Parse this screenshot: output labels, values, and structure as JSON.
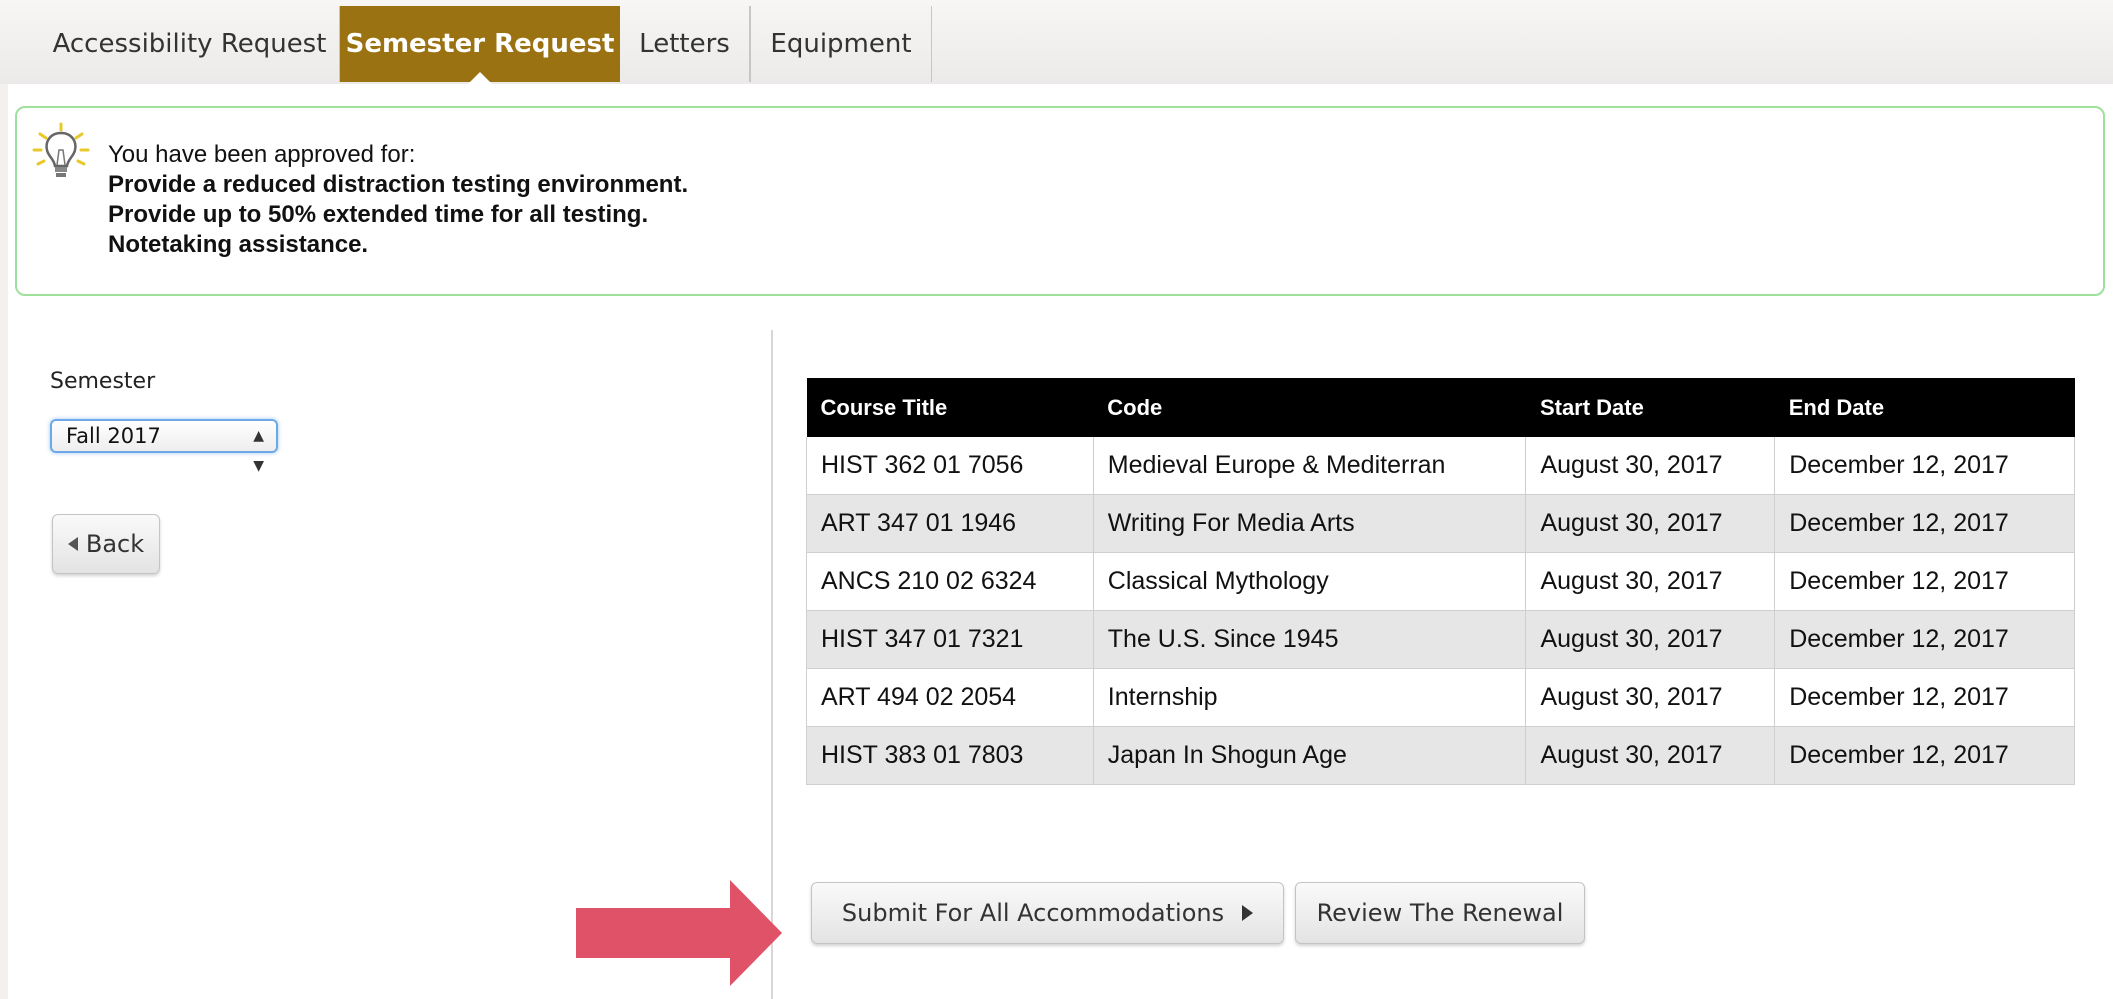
{
  "tabs": [
    {
      "label": "Accessibility Request",
      "active": false
    },
    {
      "label": "Semester Request",
      "active": true
    },
    {
      "label": "Letters",
      "active": false
    },
    {
      "label": "Equipment",
      "active": false
    }
  ],
  "alert": {
    "icon": "lightbulb-icon",
    "intro": "You have been approved for:",
    "items": [
      "Provide a reduced distraction testing environment.",
      "Provide up to 50% extended time for all testing.",
      "Notetaking assistance."
    ]
  },
  "semester": {
    "label": "Semester",
    "selected": "Fall 2017"
  },
  "back_label": "Back",
  "table": {
    "headers": [
      "Course Title",
      "Code",
      "Start Date",
      "End Date"
    ],
    "rows": [
      [
        "HIST 362 01 7056",
        "Medieval Europe & Mediterran",
        "August 30, 2017",
        "December 12, 2017"
      ],
      [
        "ART 347 01 1946",
        "Writing For Media Arts",
        "August 30, 2017",
        "December 12, 2017"
      ],
      [
        "ANCS 210 02 6324",
        "Classical Mythology",
        "August 30, 2017",
        "December 12, 2017"
      ],
      [
        "HIST 347 01 7321",
        "The U.S. Since 1945",
        "August 30, 2017",
        "December 12, 2017"
      ],
      [
        "ART 494 02 2054",
        "Internship",
        "August 30, 2017",
        "December 12, 2017"
      ],
      [
        "HIST 383 01 7803",
        "Japan In Shogun Age",
        "August 30, 2017",
        "December 12, 2017"
      ]
    ]
  },
  "actions": {
    "submit_label": "Submit For All Accommodations",
    "review_label": "Review The Renewal"
  },
  "colors": {
    "active_tab": "#9b7211",
    "alert_border": "#9fe09a",
    "arrow": "#e05268"
  }
}
